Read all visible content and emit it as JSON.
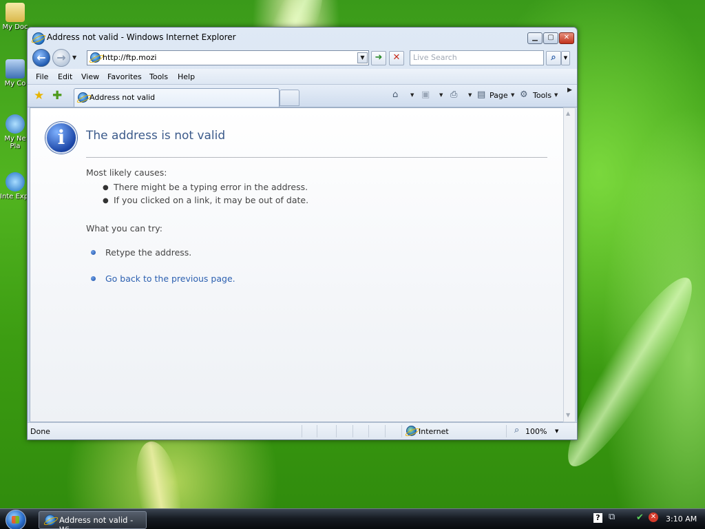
{
  "desktop": {
    "icons": [
      {
        "label": "My Doc"
      },
      {
        "label": "My Co"
      },
      {
        "label": "My Ne Pla"
      },
      {
        "label": "Inte Expl"
      }
    ]
  },
  "window": {
    "title": "Address not valid - Windows Internet Explorer",
    "minimize_icon": "minimize-icon",
    "maximize_icon": "maximize-icon",
    "close_icon": "close-icon"
  },
  "nav": {
    "address_value": "http://ftp.mozi",
    "search_placeholder": "Live Search"
  },
  "menu": {
    "items": [
      "File",
      "Edit",
      "View",
      "Favorites",
      "Tools",
      "Help"
    ]
  },
  "tabs": {
    "active_label": "Address not valid"
  },
  "command_bar": {
    "page_label": "Page",
    "tools_label": "Tools"
  },
  "content": {
    "title": "The address is not valid",
    "causes_heading": "Most likely causes:",
    "causes": [
      "There might be a typing error in the address.",
      "If you clicked on a link, it may be out of date."
    ],
    "try_heading": "What you can try:",
    "retype": "Retype the address.",
    "back_link": "Go back to the previous page."
  },
  "status": {
    "text": "Done",
    "zone": "Internet",
    "zoom": "100%"
  },
  "taskbar": {
    "ie_button": "Address not valid - Wi...",
    "clock": "3:10 AM"
  },
  "colors": {
    "title_blue": "#3b5a8a",
    "link_blue": "#2b5fb0",
    "close_red": "#c1311b"
  }
}
